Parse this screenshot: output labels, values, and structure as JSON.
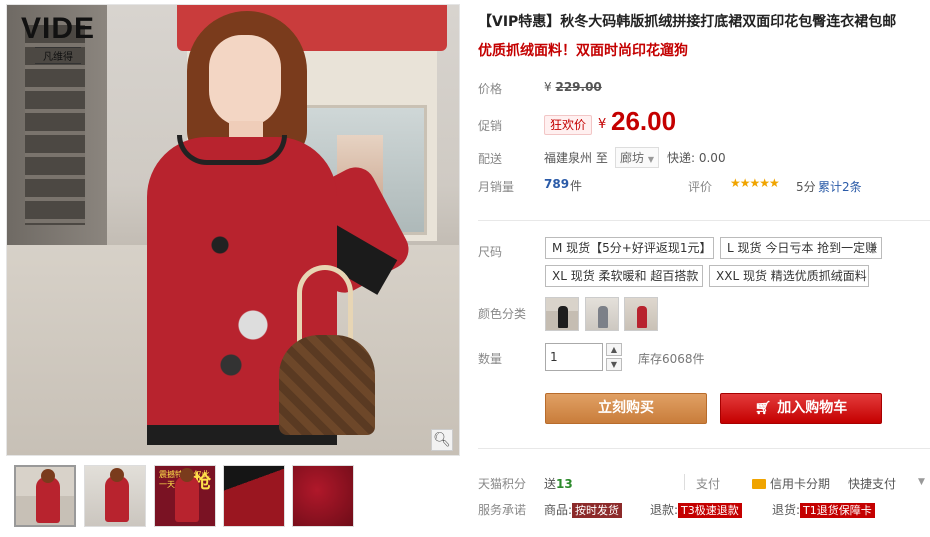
{
  "brand": {
    "name": "VIDE",
    "sub": "凡维得"
  },
  "product": {
    "title": "【VIP特惠】秋冬大码韩版抓绒拼接打底裙双面印花包臀连衣裙包邮",
    "subtitle": "优质抓绒面料！双面时尚印花遛狗"
  },
  "price": {
    "label": "价格",
    "currency": "¥",
    "original": "229.00"
  },
  "promo": {
    "label": "促销",
    "tag": "狂欢价",
    "currency": "¥",
    "price": "26.00"
  },
  "shipping": {
    "label": "配送",
    "from": "福建泉州 至",
    "to": "廊坊",
    "fee": "快递: 0.00"
  },
  "sales": {
    "label": "月销量",
    "count": "789",
    "unit": "件",
    "rating_label": "评价",
    "stars": "★★★★★",
    "score": "5分",
    "reviews": "累计2条"
  },
  "sku": {
    "size_label": "尺码",
    "sizes": [
      "M 现货【5分+好评返现1元】",
      "L 现货 今日亏本 抢到一定赚",
      "XL 现货 柔软暖和 超百搭款",
      "XXL 现货 精选优质抓绒面料"
    ],
    "color_label": "颜色分类"
  },
  "quantity": {
    "label": "数量",
    "value": "1",
    "stock": "库存6068件"
  },
  "actions": {
    "buy": "立刻购买",
    "cart": "加入购物车"
  },
  "points": {
    "label": "天猫积分",
    "prefix": "送",
    "value": "13"
  },
  "payment": {
    "label": "支付",
    "credit": "信用卡分期",
    "fast": "快捷支付"
  },
  "service": {
    "label": "服务承诺",
    "items": [
      {
        "prefix": "商品:",
        "tag": "按时发货"
      },
      {
        "prefix": "退款:",
        "tag": "T3极速退款"
      },
      {
        "prefix": "退货:",
        "tag": "T1退货保障卡"
      }
    ]
  },
  "gallery": {
    "thumb3_badge": "震撼特价 仅此一天",
    "thumb3_big": "抢"
  },
  "colors": {
    "accent": "#c40000",
    "buy": "#c97d3b",
    "link": "#2b5ba8"
  }
}
